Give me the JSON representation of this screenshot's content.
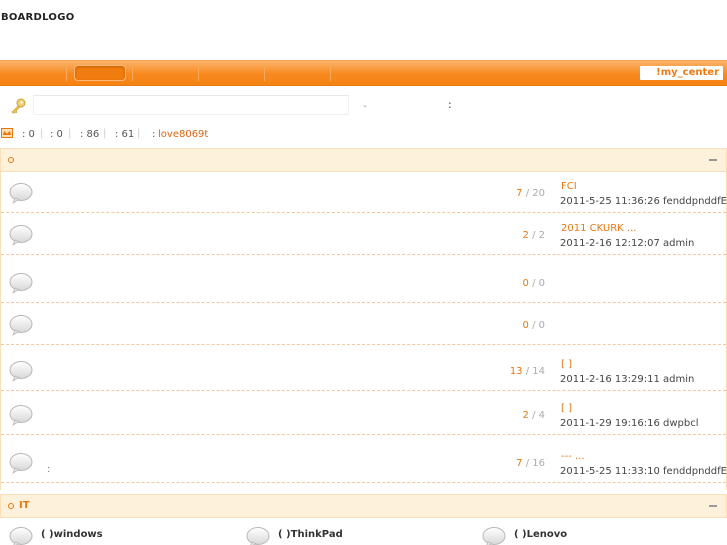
{
  "header": {
    "logo": "BOARDLOGO"
  },
  "nav": {
    "my_center": "!my_center"
  },
  "search": {
    "value": "",
    "dropdown_arrow": "⌄",
    "colon": ":"
  },
  "stats": {
    "items": [
      ": 0",
      ": 0",
      ": 86",
      ": 61"
    ],
    "newest_prefix": ":",
    "newest_member": "love8069t"
  },
  "categories": [
    {
      "title": "",
      "forums": [
        {
          "note": "",
          "topics": "7",
          "posts": " / 20",
          "last_title": "FCI",
          "last_meta": "2011-5-25 11:36:26 fenddpnddfE"
        },
        {
          "note": "",
          "topics": "2",
          "posts": " / 2",
          "last_title": "2011 CKURK         ...",
          "last_meta": "2011-2-16 12:12:07 admin"
        },
        {
          "note": "",
          "topics": "0",
          "posts": " / 0",
          "last_title": "",
          "last_meta": ""
        },
        {
          "note": "",
          "topics": "0",
          "posts": " / 0",
          "last_title": "",
          "last_meta": ""
        },
        {
          "note": "",
          "topics": "13",
          "posts": " / 14",
          "last_title": "[ ]",
          "last_meta": "2011-2-16 13:29:11 admin"
        },
        {
          "note": "",
          "topics": "2",
          "posts": " / 4",
          "last_title": "[ ]",
          "last_meta": "2011-1-29 19:16:16 dwpbcl"
        },
        {
          "note": ":",
          "topics": "7",
          "posts": " / 16",
          "last_title": "  ---            ...",
          "last_meta": "2011-5-25 11:33:10 fenddpnddfE"
        }
      ]
    },
    {
      "title": "IT",
      "subforums": [
        "(   )windows",
        "(   )ThinkPad",
        "(   )Lenovo"
      ]
    }
  ],
  "colors": {
    "accent": "#f7891e",
    "link": "#e8780f",
    "category_bg": "#fdf1dc"
  },
  "icons": [
    "key-icon",
    "crown-icon",
    "speech-bubble-icon",
    "collapse-icon"
  ]
}
